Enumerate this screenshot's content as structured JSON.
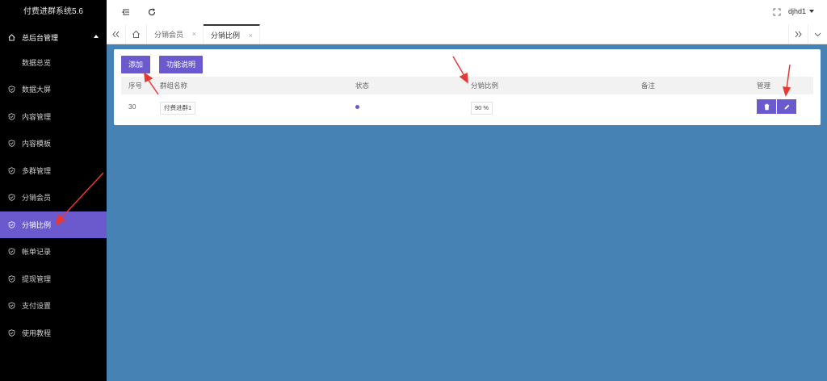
{
  "sidebar": {
    "brand": "付费进群系统5.6",
    "group": {
      "label": "总后台管理",
      "icon": "home-icon"
    },
    "sub_items": [
      {
        "label": "数据总览"
      }
    ],
    "items": [
      {
        "label": "数据大屏",
        "icon": "shield-check-icon"
      },
      {
        "label": "内容管理",
        "icon": "shield-check-icon"
      },
      {
        "label": "内容模板",
        "icon": "shield-check-icon"
      },
      {
        "label": "多群管理",
        "icon": "shield-check-icon"
      },
      {
        "label": "分销会员",
        "icon": "shield-check-icon"
      },
      {
        "label": "分销比例",
        "icon": "shield-check-icon",
        "active": true
      },
      {
        "label": "帐单记录",
        "icon": "shield-check-icon"
      },
      {
        "label": "提现管理",
        "icon": "shield-check-icon"
      },
      {
        "label": "支付设置",
        "icon": "shield-check-icon"
      },
      {
        "label": "使用教程",
        "icon": "shield-check-icon"
      }
    ],
    "active_color": "#6a5acd"
  },
  "topbar": {
    "user": "djhd1",
    "icons": [
      "menu-fold-icon",
      "refresh-icon",
      "fullscreen-icon"
    ]
  },
  "tabs": [
    {
      "label": "分销会员",
      "close": "×"
    },
    {
      "label": "分销比例",
      "close": "×",
      "active": true
    }
  ],
  "toolbar": {
    "add_label": "添加",
    "info_label": "功能说明"
  },
  "table": {
    "headers": {
      "id": "序号",
      "group": "群组名称",
      "status": "状态",
      "ratio": "分销比例",
      "note": "备注",
      "manage": "管理"
    },
    "rows": [
      {
        "id": "30",
        "group": "付费进群1",
        "status_color": "#6a5acd",
        "ratio": "90 %",
        "note": ""
      }
    ]
  },
  "colors": {
    "accent": "#6a5acd",
    "background": "#4682b4",
    "sidebar": "#000000",
    "annotation_arrow": "#e53935"
  }
}
